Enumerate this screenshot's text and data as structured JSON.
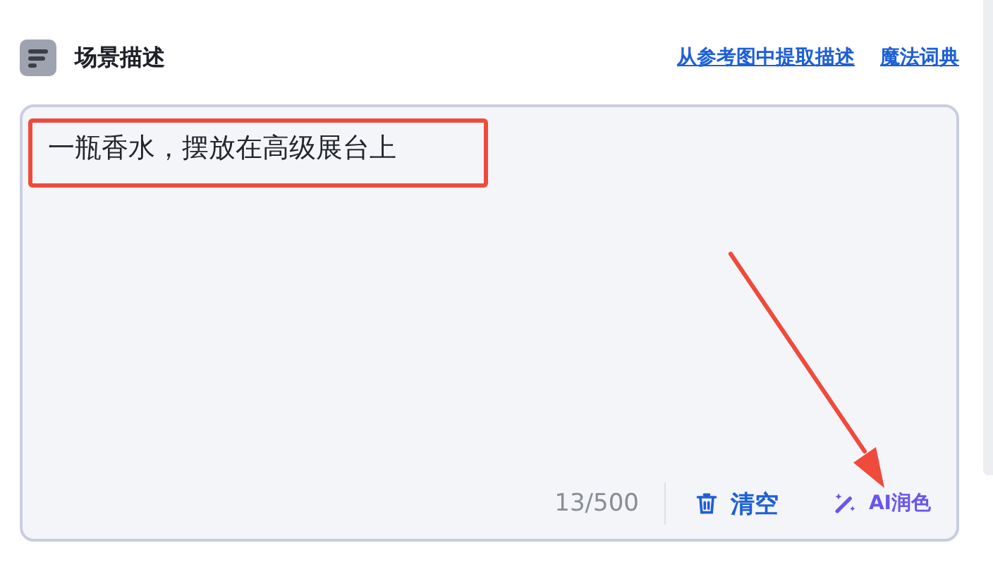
{
  "header": {
    "title": "场景描述",
    "links": [
      "从参考图中提取描述",
      "魔法词典"
    ]
  },
  "description": {
    "value": "一瓶香水，摆放在高级展台上",
    "count": "13/500"
  },
  "actions": [
    {
      "kind": "clear",
      "label": "清空"
    },
    {
      "kind": "polish",
      "label": "AI润色"
    }
  ],
  "annotations": {
    "highlight_box": true,
    "arrow": true
  }
}
